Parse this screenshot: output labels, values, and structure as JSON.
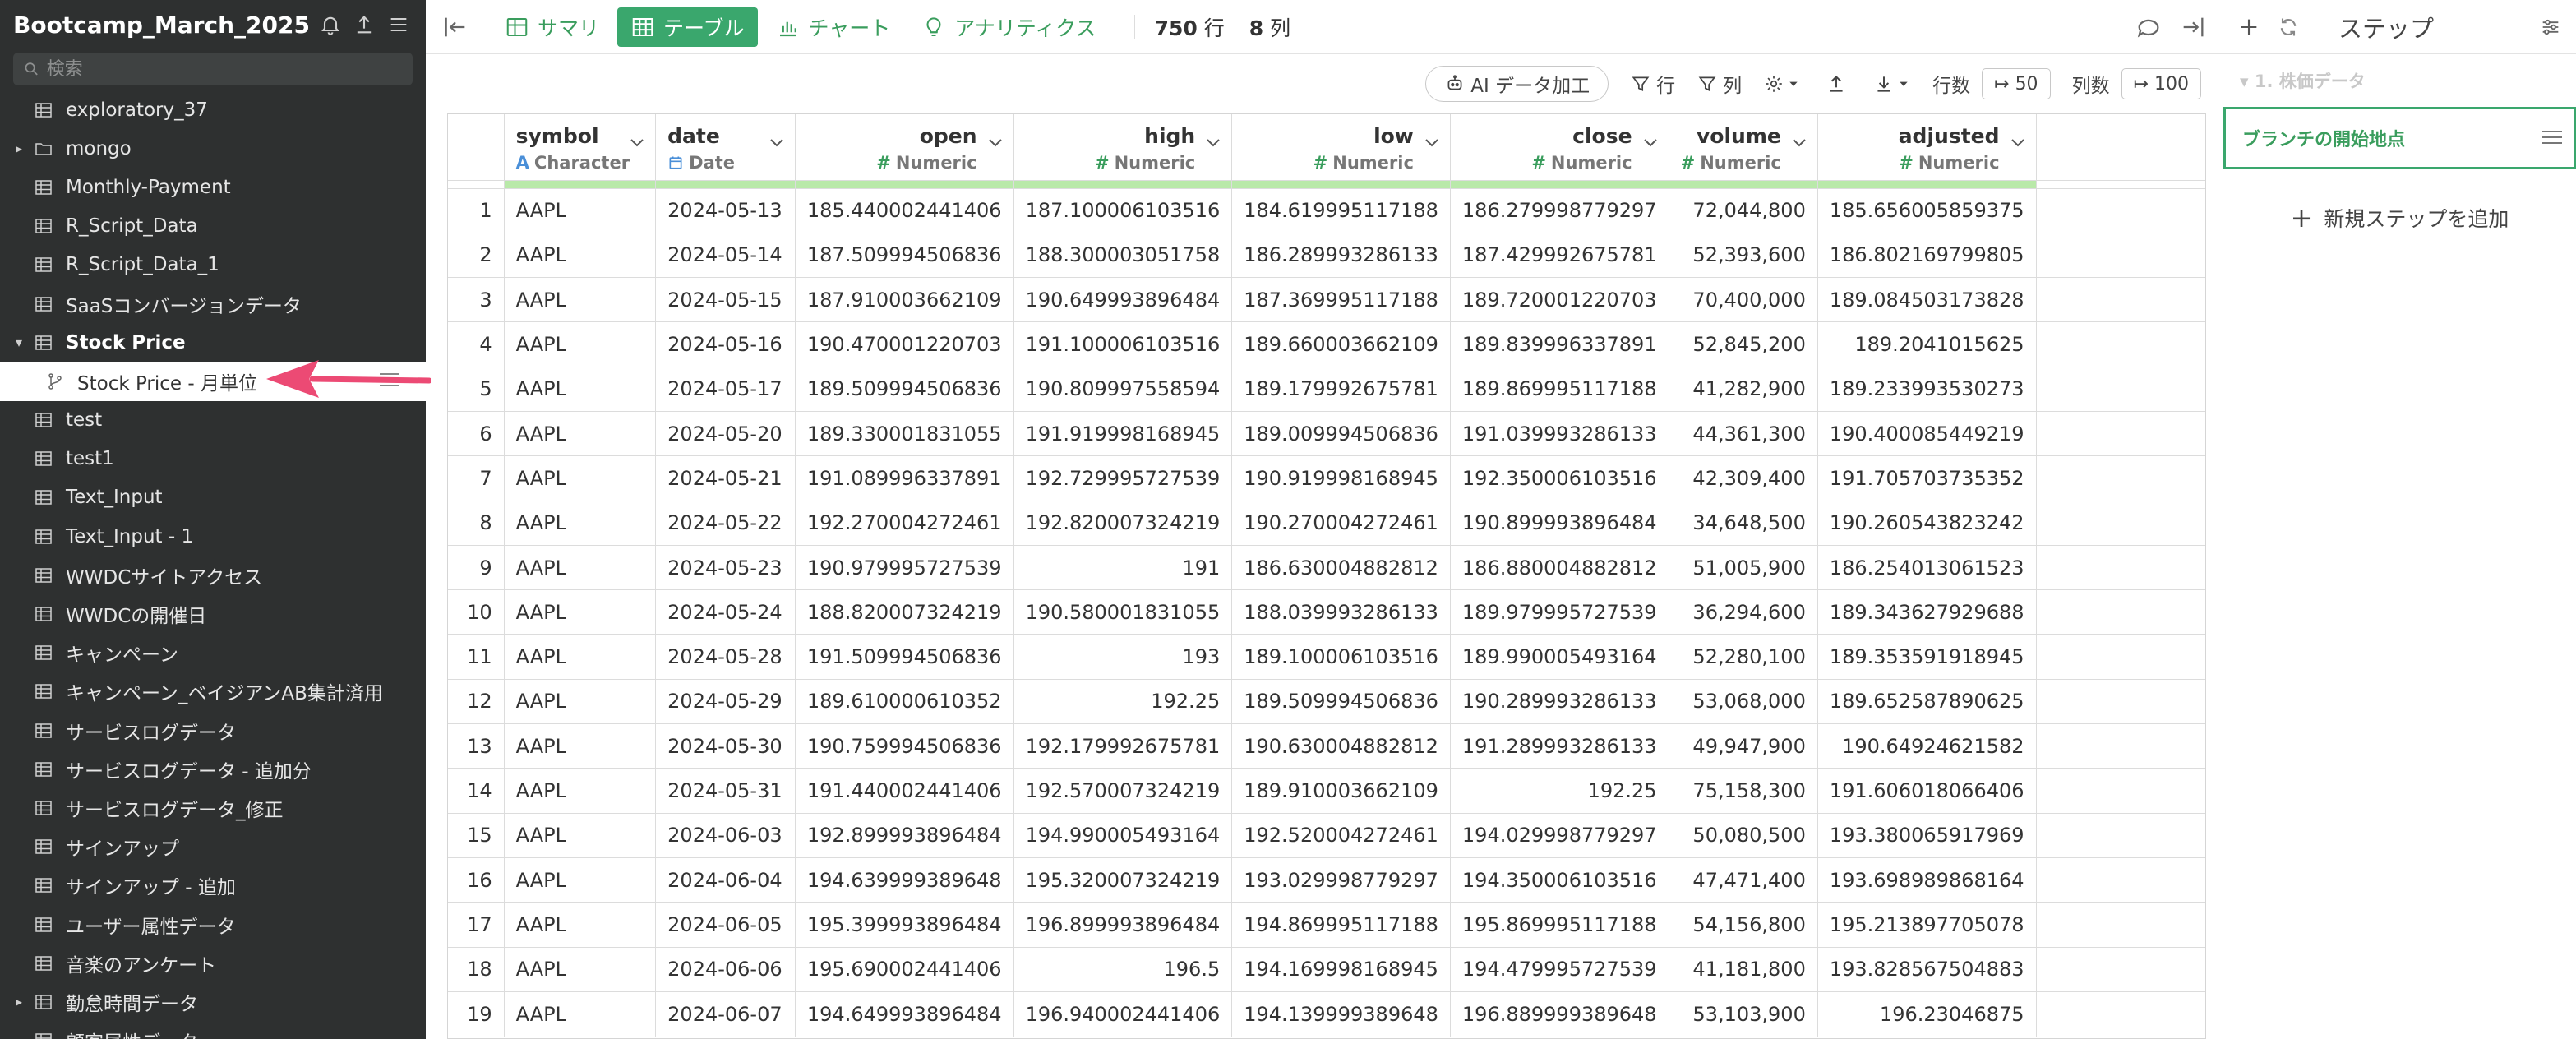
{
  "sidebar": {
    "project_title": "Bootcamp_March_2025",
    "search_placeholder": "検索",
    "items": [
      {
        "label": "exploratory_37",
        "icon": "table",
        "toggle": "",
        "level": 0
      },
      {
        "label": "mongo",
        "icon": "folder",
        "toggle": "▸",
        "level": 0
      },
      {
        "label": "Monthly-Payment",
        "icon": "table",
        "toggle": "",
        "level": 0
      },
      {
        "label": "R_Script_Data",
        "icon": "table",
        "toggle": "",
        "level": 0
      },
      {
        "label": "R_Script_Data_1",
        "icon": "table",
        "toggle": "",
        "level": 0
      },
      {
        "label": "SaaSコンバージョンデータ",
        "icon": "table",
        "toggle": "",
        "level": 0
      },
      {
        "label": "Stock Price",
        "icon": "table",
        "toggle": "▾",
        "level": 0,
        "bold": true
      },
      {
        "label": "Stock Price - 月単位",
        "icon": "branch",
        "toggle": "",
        "level": 1,
        "selected": true
      },
      {
        "label": "test",
        "icon": "table",
        "toggle": "",
        "level": 0
      },
      {
        "label": "test1",
        "icon": "table",
        "toggle": "",
        "level": 0
      },
      {
        "label": "Text_Input",
        "icon": "table",
        "toggle": "",
        "level": 0
      },
      {
        "label": "Text_Input - 1",
        "icon": "table",
        "toggle": "",
        "level": 0
      },
      {
        "label": "WWDCサイトアクセス",
        "icon": "table",
        "toggle": "",
        "level": 0
      },
      {
        "label": "WWDCの開催日",
        "icon": "table",
        "toggle": "",
        "level": 0
      },
      {
        "label": "キャンペーン",
        "icon": "table",
        "toggle": "",
        "level": 0
      },
      {
        "label": "キャンペーン_ベイジアンAB集計済用",
        "icon": "table",
        "toggle": "",
        "level": 0
      },
      {
        "label": "サービスログデータ",
        "icon": "table",
        "toggle": "",
        "level": 0
      },
      {
        "label": "サービスログデータ - 追加分",
        "icon": "table",
        "toggle": "",
        "level": 0
      },
      {
        "label": "サービスログデータ_修正",
        "icon": "table",
        "toggle": "",
        "level": 0
      },
      {
        "label": "サインアップ",
        "icon": "table",
        "toggle": "",
        "level": 0
      },
      {
        "label": "サインアップ - 追加",
        "icon": "table",
        "toggle": "",
        "level": 0
      },
      {
        "label": "ユーザー属性データ",
        "icon": "table",
        "toggle": "",
        "level": 0
      },
      {
        "label": "音楽のアンケート",
        "icon": "table",
        "toggle": "",
        "level": 0
      },
      {
        "label": "勤怠時間データ",
        "icon": "table",
        "toggle": "▸",
        "level": 0
      },
      {
        "label": "顧客属性データ",
        "icon": "table",
        "toggle": "",
        "level": 0
      }
    ]
  },
  "toolbar": {
    "tabs": [
      {
        "label": "サマリ",
        "icon": "summary-icon",
        "active": false
      },
      {
        "label": "テーブル",
        "icon": "table-icon",
        "active": true
      },
      {
        "label": "チャート",
        "icon": "chart-icon",
        "active": false
      },
      {
        "label": "アナリティクス",
        "icon": "lightbulb-icon",
        "active": false
      }
    ],
    "rows_count": "750",
    "rows_unit": "行",
    "cols_count": "8",
    "cols_unit": "列"
  },
  "toolbar2": {
    "ai_label": "AI データ加工",
    "row_filter_label": "行",
    "col_filter_label": "列",
    "rows_label": "行数",
    "rows_value": "50",
    "cols_label": "列数",
    "cols_value": "100"
  },
  "table": {
    "columns": [
      {
        "name": "symbol",
        "type": "Character",
        "type_icon": "A",
        "align": "left"
      },
      {
        "name": "date",
        "type": "Date",
        "type_icon": "calendar",
        "align": "left"
      },
      {
        "name": "open",
        "type": "Numeric",
        "type_icon": "#",
        "align": "right"
      },
      {
        "name": "high",
        "type": "Numeric",
        "type_icon": "#",
        "align": "right"
      },
      {
        "name": "low",
        "type": "Numeric",
        "type_icon": "#",
        "align": "right"
      },
      {
        "name": "close",
        "type": "Numeric",
        "type_icon": "#",
        "align": "right"
      },
      {
        "name": "volume",
        "type": "Numeric",
        "type_icon": "#",
        "align": "right"
      },
      {
        "name": "adjusted",
        "type": "Numeric",
        "type_icon": "#",
        "align": "right"
      }
    ],
    "rows": [
      [
        "1",
        "AAPL",
        "2024-05-13",
        "185.440002441406",
        "187.100006103516",
        "184.619995117188",
        "186.279998779297",
        "72,044,800",
        "185.656005859375"
      ],
      [
        "2",
        "AAPL",
        "2024-05-14",
        "187.509994506836",
        "188.300003051758",
        "186.289993286133",
        "187.429992675781",
        "52,393,600",
        "186.802169799805"
      ],
      [
        "3",
        "AAPL",
        "2024-05-15",
        "187.910003662109",
        "190.649993896484",
        "187.369995117188",
        "189.720001220703",
        "70,400,000",
        "189.084503173828"
      ],
      [
        "4",
        "AAPL",
        "2024-05-16",
        "190.470001220703",
        "191.100006103516",
        "189.660003662109",
        "189.839996337891",
        "52,845,200",
        "189.2041015625"
      ],
      [
        "5",
        "AAPL",
        "2024-05-17",
        "189.509994506836",
        "190.809997558594",
        "189.179992675781",
        "189.869995117188",
        "41,282,900",
        "189.233993530273"
      ],
      [
        "6",
        "AAPL",
        "2024-05-20",
        "189.330001831055",
        "191.919998168945",
        "189.009994506836",
        "191.039993286133",
        "44,361,300",
        "190.400085449219"
      ],
      [
        "7",
        "AAPL",
        "2024-05-21",
        "191.089996337891",
        "192.729995727539",
        "190.919998168945",
        "192.350006103516",
        "42,309,400",
        "191.705703735352"
      ],
      [
        "8",
        "AAPL",
        "2024-05-22",
        "192.270004272461",
        "192.820007324219",
        "190.270004272461",
        "190.899993896484",
        "34,648,500",
        "190.260543823242"
      ],
      [
        "9",
        "AAPL",
        "2024-05-23",
        "190.979995727539",
        "191",
        "186.630004882812",
        "186.880004882812",
        "51,005,900",
        "186.254013061523"
      ],
      [
        "10",
        "AAPL",
        "2024-05-24",
        "188.820007324219",
        "190.580001831055",
        "188.039993286133",
        "189.979995727539",
        "36,294,600",
        "189.343627929688"
      ],
      [
        "11",
        "AAPL",
        "2024-05-28",
        "191.509994506836",
        "193",
        "189.100006103516",
        "189.990005493164",
        "52,280,100",
        "189.353591918945"
      ],
      [
        "12",
        "AAPL",
        "2024-05-29",
        "189.610000610352",
        "192.25",
        "189.509994506836",
        "190.289993286133",
        "53,068,000",
        "189.652587890625"
      ],
      [
        "13",
        "AAPL",
        "2024-05-30",
        "190.759994506836",
        "192.179992675781",
        "190.630004882812",
        "191.289993286133",
        "49,947,900",
        "190.64924621582"
      ],
      [
        "14",
        "AAPL",
        "2024-05-31",
        "191.440002441406",
        "192.570007324219",
        "189.910003662109",
        "192.25",
        "75,158,300",
        "191.606018066406"
      ],
      [
        "15",
        "AAPL",
        "2024-06-03",
        "192.899993896484",
        "194.990005493164",
        "192.520004272461",
        "194.029998779297",
        "50,080,500",
        "193.380065917969"
      ],
      [
        "16",
        "AAPL",
        "2024-06-04",
        "194.639999389648",
        "195.320007324219",
        "193.029998779297",
        "194.350006103516",
        "47,471,400",
        "193.698989868164"
      ],
      [
        "17",
        "AAPL",
        "2024-06-05",
        "195.399993896484",
        "196.899993896484",
        "194.869995117188",
        "195.869995117188",
        "54,156,800",
        "195.213897705078"
      ],
      [
        "18",
        "AAPL",
        "2024-06-06",
        "195.690002441406",
        "196.5",
        "194.169998168945",
        "194.479995727539",
        "41,181,800",
        "193.828567504883"
      ],
      [
        "19",
        "AAPL",
        "2024-06-07",
        "194.649993896484",
        "196.940002441406",
        "194.139999389648",
        "196.889999389648",
        "53,103,900",
        "196.23046875"
      ]
    ]
  },
  "right_panel": {
    "title": "ステップ",
    "dataset_label": "▾ 1. 株価データ",
    "step_label": "ブランチの開始地点",
    "add_step_label": "新規ステップを追加"
  },
  "colors": {
    "sidebar_bg": "#2e3030",
    "accent_green": "#3aa76d",
    "quality_bar": "#b9e9a9",
    "annotation_arrow": "#ec4a74"
  }
}
